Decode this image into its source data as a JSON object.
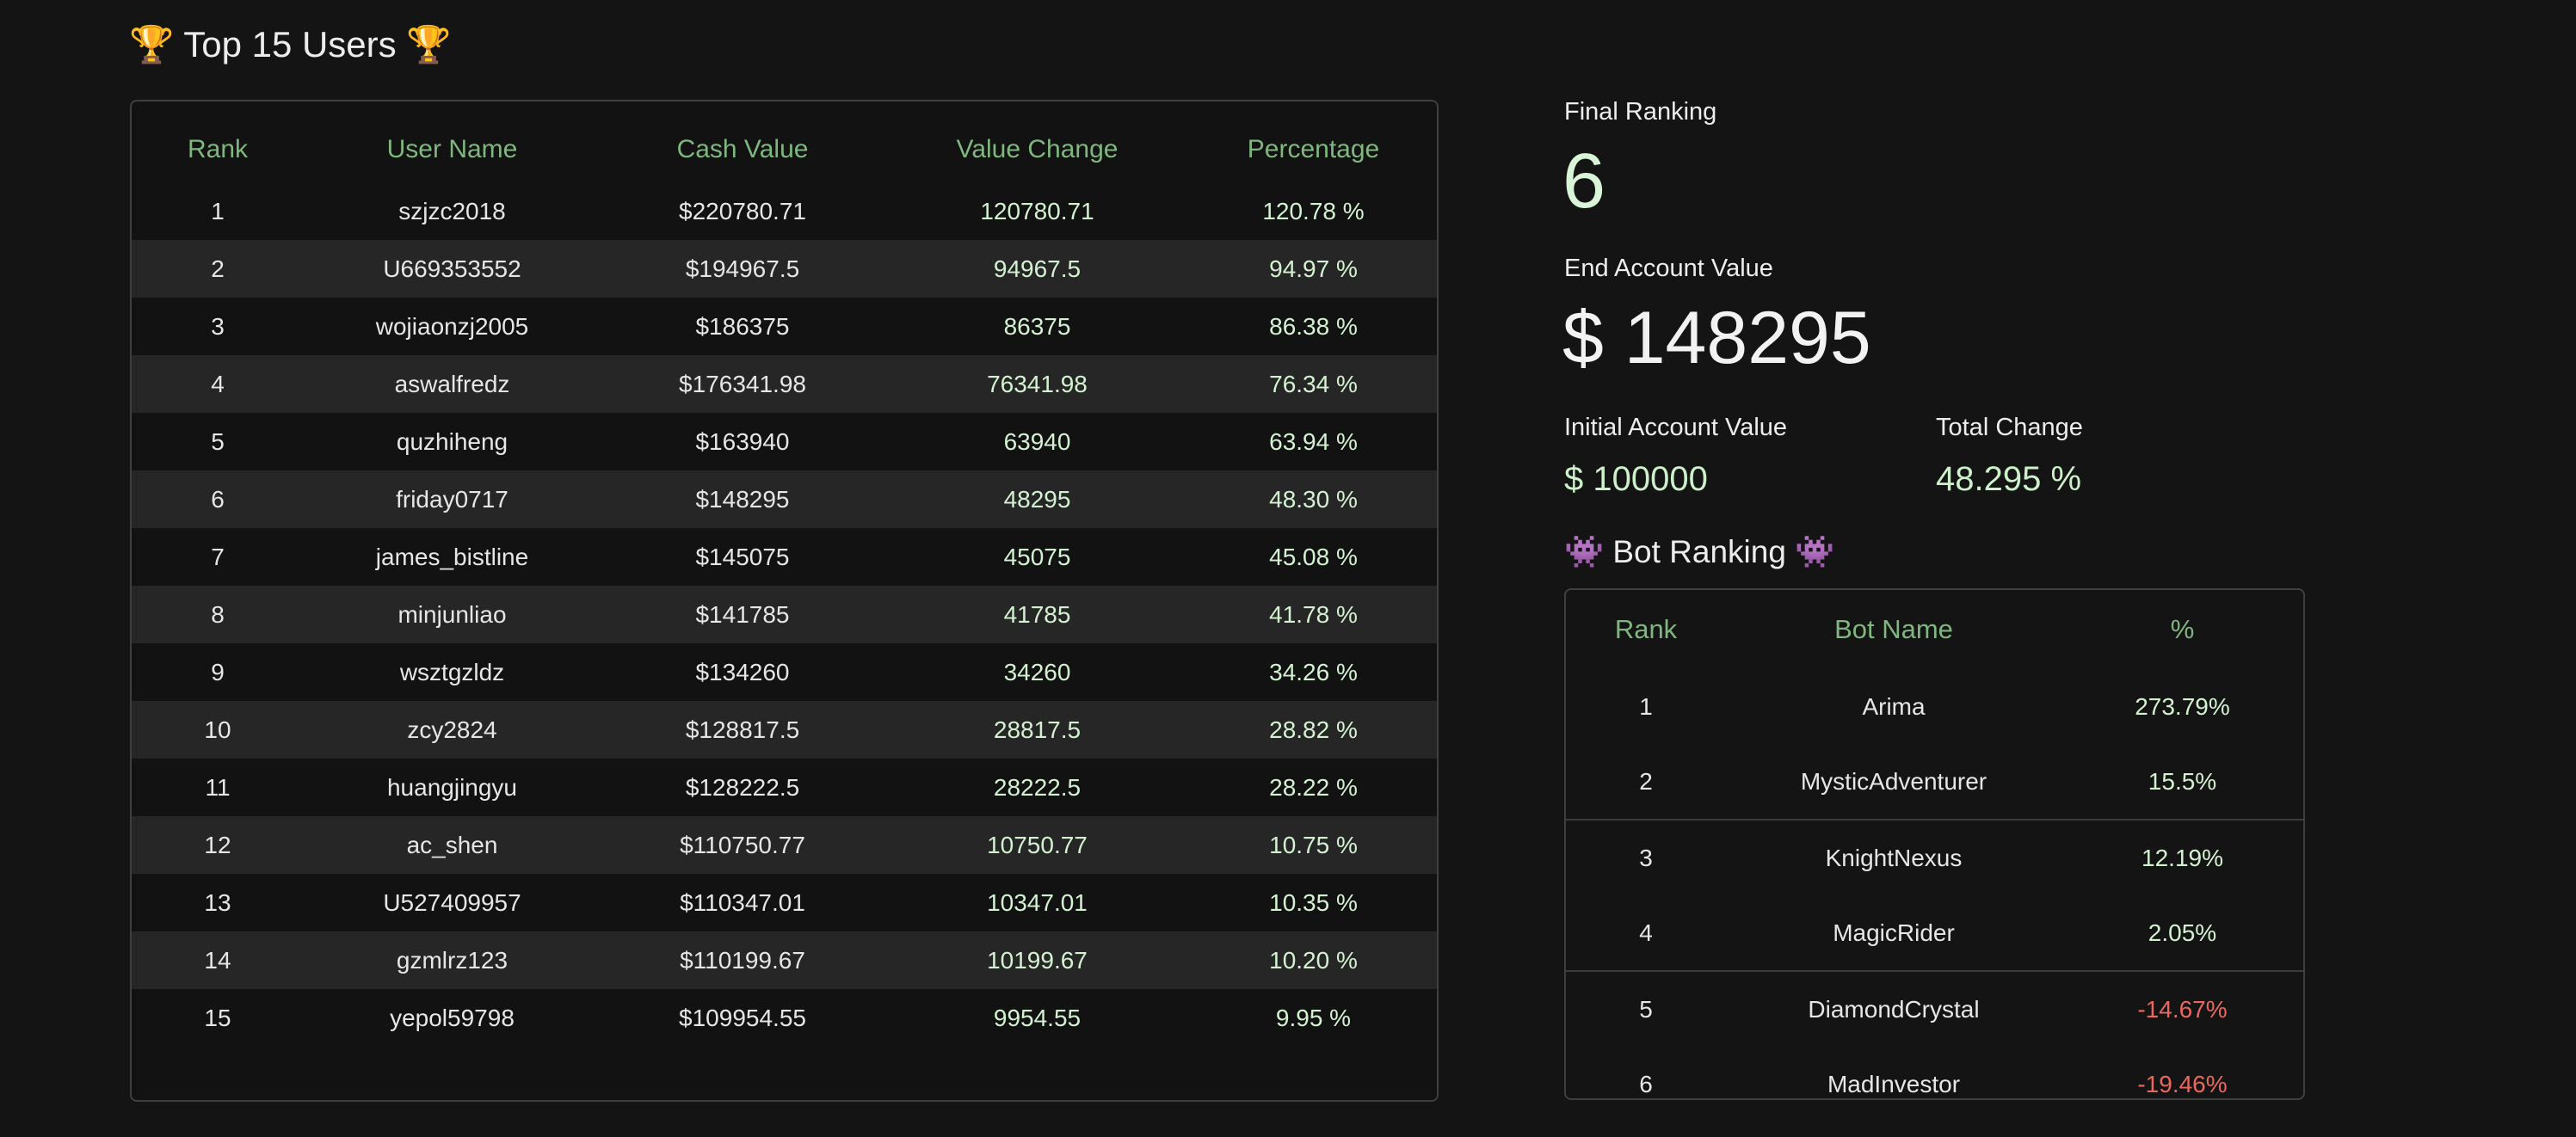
{
  "users": {
    "title": "🏆 Top 15 Users 🏆",
    "headers": [
      "Rank",
      "User Name",
      "Cash Value",
      "Value Change",
      "Percentage"
    ],
    "rows": [
      [
        "1",
        "szjzc2018",
        "$220780.71",
        "120780.71",
        "120.78 %"
      ],
      [
        "2",
        "U669353552",
        "$194967.5",
        "94967.5",
        "94.97 %"
      ],
      [
        "3",
        "wojiaonzj2005",
        "$186375",
        "86375",
        "86.38 %"
      ],
      [
        "4",
        "aswalfredz",
        "$176341.98",
        "76341.98",
        "76.34 %"
      ],
      [
        "5",
        "quzhiheng",
        "$163940",
        "63940",
        "63.94 %"
      ],
      [
        "6",
        "friday0717",
        "$148295",
        "48295",
        "48.30 %"
      ],
      [
        "7",
        "james_bistline",
        "$145075",
        "45075",
        "45.08 %"
      ],
      [
        "8",
        "minjunliao",
        "$141785",
        "41785",
        "41.78 %"
      ],
      [
        "9",
        "wsztgzldz",
        "$134260",
        "34260",
        "34.26 %"
      ],
      [
        "10",
        "zcy2824",
        "$128817.5",
        "28817.5",
        "28.82 %"
      ],
      [
        "11",
        "huangjingyu",
        "$128222.5",
        "28222.5",
        "28.22 %"
      ],
      [
        "12",
        "ac_shen",
        "$110750.77",
        "10750.77",
        "10.75 %"
      ],
      [
        "13",
        "U527409957",
        "$110347.01",
        "10347.01",
        "10.35 %"
      ],
      [
        "14",
        "gzmlrz123",
        "$110199.67",
        "10199.67",
        "10.20 %"
      ],
      [
        "15",
        "yepol59798",
        "$109954.55",
        "9954.55",
        "9.95 %"
      ]
    ]
  },
  "summary": {
    "final_ranking_label": "Final Ranking",
    "final_ranking_value": "6",
    "end_value_label": "End Account Value",
    "end_value": "$ 148295",
    "initial_value_label": "Initial Account Value",
    "initial_value": "$ 100000",
    "total_change_label": "Total Change",
    "total_change": "48.295 %"
  },
  "bots": {
    "title": "👾 Bot Ranking 👾",
    "headers": [
      "Rank",
      "Bot Name",
      "%"
    ],
    "rows": [
      [
        "1",
        "Arima",
        "273.79%"
      ],
      [
        "2",
        "MysticAdventurer",
        "15.5%"
      ],
      [
        "3",
        "KnightNexus",
        "12.19%"
      ],
      [
        "4",
        "MagicRider",
        "2.05%"
      ],
      [
        "5",
        "DiamondCrystal",
        "-14.67%"
      ],
      [
        "6",
        "MadInvestor",
        "-19.46%"
      ]
    ]
  },
  "colors": {
    "background": "#141414",
    "header_green": "#7fb77e",
    "positive": "#d4f2d2",
    "negative": "#e8685f",
    "alt_row": "#262626"
  }
}
